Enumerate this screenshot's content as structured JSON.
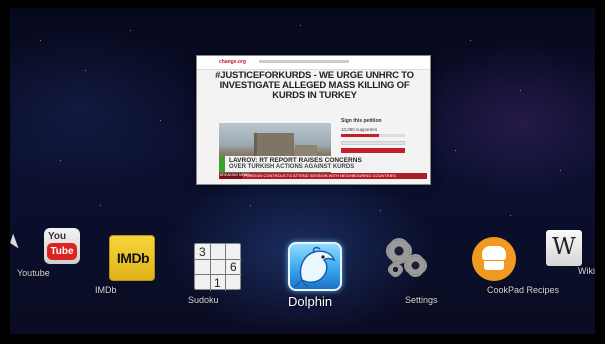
{
  "preview": {
    "site_logo": "change.org",
    "headline": "#JUSTICEFORKURDS - WE URGE UNHRC TO INVESTIGATE ALLEGED MASS KILLING OF KURDS IN TURKEY",
    "sign_title": "Sign this petition",
    "sign_count": "10,090 supporters",
    "ticker_line1": "LAVROV: RT REPORT RAISES CONCERNS",
    "ticker_line2": "OVER TURKISH ACTIONS AGAINST KURDS",
    "crawl_tag": "BREAKING NEWS",
    "crawl_text": "FOREIGN CONTROLS TO ATTEND SESSION WITH NEIGHBOURING COUNTRIES"
  },
  "dock": {
    "youtube": {
      "label": "Youtube",
      "icon": "youtube-icon",
      "you": "You",
      "tube": "Tube"
    },
    "imdb": {
      "label": "IMDb",
      "icon": "imdb-icon",
      "logo": "IMDb"
    },
    "sudoku": {
      "label": "Sudoku",
      "icon": "sudoku-icon",
      "n1": "3",
      "n2": "6",
      "n3": "1"
    },
    "dolphin": {
      "label": "Dolphin",
      "icon": "dolphin-icon"
    },
    "settings": {
      "label": "Settings",
      "icon": "gear-icon"
    },
    "cookpad": {
      "label": "CookPad Recipes",
      "icon": "chef-hat-icon"
    },
    "wikipedia": {
      "label": "Wikipe",
      "icon": "wikipedia-icon",
      "logo": "W"
    }
  }
}
